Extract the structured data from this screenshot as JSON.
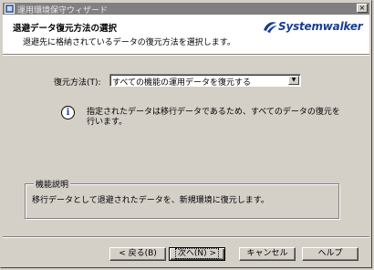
{
  "window": {
    "title": "運用環境保守ウィザード",
    "close_glyph": "×"
  },
  "header": {
    "title": "退避データ復元方法の選択",
    "subtitle": "退避先に格納されているデータの復元方法を選択します。",
    "logo_text": "Systemwalker"
  },
  "form": {
    "restore_method_label": "復元方法(T):",
    "restore_method_value": "すべての機能の運用データを復元する"
  },
  "info": {
    "icon": "info-icon",
    "text": "指定されたデータは移行データであるため、すべてのデータの復元を行います。"
  },
  "description": {
    "group_label": "機能説明",
    "text": "移行データとして退避されたデータを、新規環境に復元します。"
  },
  "buttons": {
    "back": "< 戻る(B)",
    "next": "次へ(N) >",
    "cancel": "キャンセル",
    "help": "ヘルプ"
  },
  "colors": {
    "titlebar_inactive": "#808080",
    "logo_blue": "#1a3d8f",
    "face": "#d4d0c8"
  }
}
